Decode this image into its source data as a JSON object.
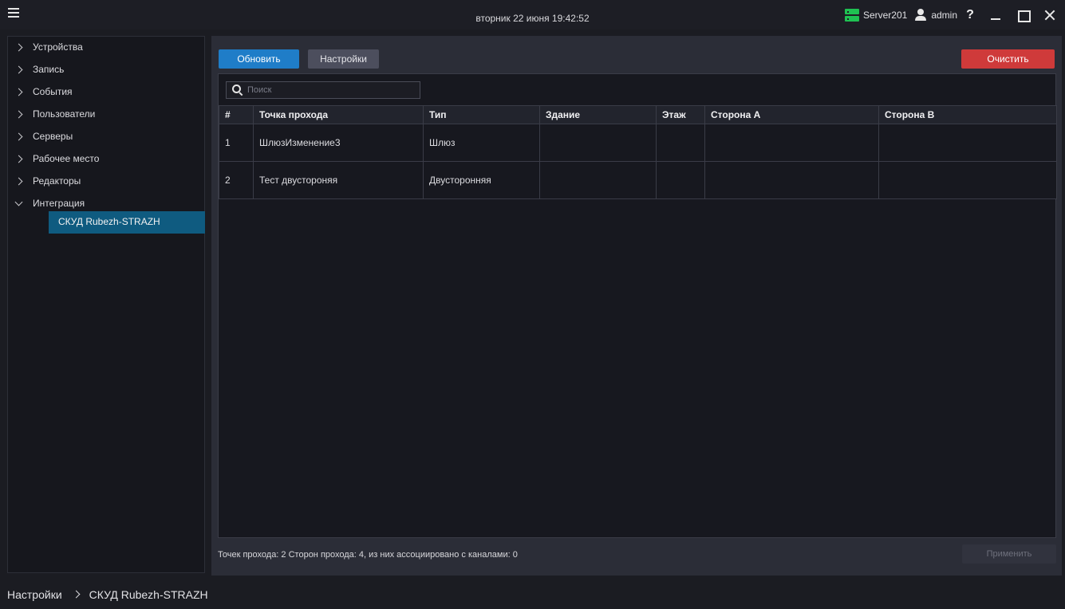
{
  "titlebar": {
    "datetime": "вторник 22 июня 19:42:52",
    "server": "Server201",
    "user": "admin",
    "help": "?"
  },
  "sidebar": {
    "items": [
      {
        "label": "Устройства",
        "expanded": false
      },
      {
        "label": "Запись",
        "expanded": false
      },
      {
        "label": "События",
        "expanded": false
      },
      {
        "label": "Пользователи",
        "expanded": false
      },
      {
        "label": "Серверы",
        "expanded": false
      },
      {
        "label": "Рабочее место",
        "expanded": false
      },
      {
        "label": "Редакторы",
        "expanded": false
      },
      {
        "label": "Интеграция",
        "expanded": true
      }
    ],
    "selected_child": "СКУД Rubezh-STRAZH"
  },
  "toolbar": {
    "refresh_label": "Обновить",
    "settings_label": "Настройки",
    "clear_label": "Очистить"
  },
  "search": {
    "placeholder": "Поиск",
    "value": ""
  },
  "table": {
    "headers": [
      "#",
      "Точка прохода",
      "Тип",
      "Здание",
      "Этаж",
      "Сторона А",
      "Сторона В"
    ],
    "rows": [
      [
        "1",
        "ШлюзИзменение3",
        "Шлюз",
        "",
        "",
        "",
        ""
      ],
      [
        "2",
        "Тест двустороняя",
        "Двусторонняя",
        "",
        "",
        "",
        ""
      ]
    ]
  },
  "footer": {
    "status": "Точек прохода: 2 Сторон прохода: 4, из них ассоциировано с каналами: 0",
    "apply_label": "Применить"
  },
  "breadcrumb": {
    "root": "Настройки",
    "current": "СКУД Rubezh-STRAZH"
  },
  "colors": {
    "accent_blue": "#1f7dc8",
    "danger_red": "#cf3a3a",
    "server_green": "#1fc152",
    "selection": "#0f5b80"
  }
}
